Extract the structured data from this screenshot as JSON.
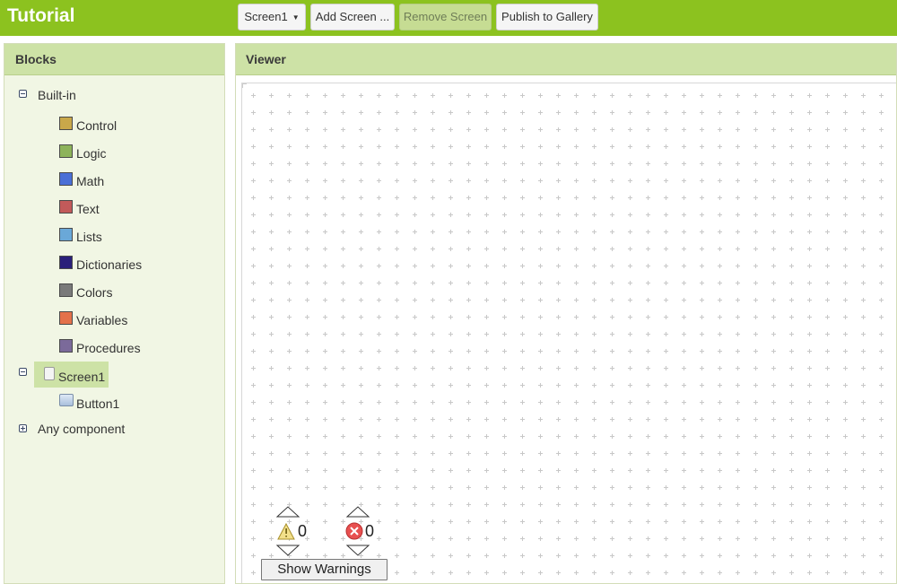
{
  "app": {
    "title": "Tutorial"
  },
  "toolbar": {
    "screen_select": "Screen1",
    "add_screen": "Add Screen ...",
    "remove_screen": "Remove Screen",
    "publish": "Publish to Gallery"
  },
  "blocks": {
    "header": "Blocks",
    "builtin_label": "Built-in",
    "builtin_items": [
      {
        "label": "Control",
        "color": "#c9a84a"
      },
      {
        "label": "Logic",
        "color": "#8db35a"
      },
      {
        "label": "Math",
        "color": "#4a6fd6"
      },
      {
        "label": "Text",
        "color": "#c25a5a"
      },
      {
        "label": "Lists",
        "color": "#6aa8d8"
      },
      {
        "label": "Dictionaries",
        "color": "#2a1f7a"
      },
      {
        "label": "Colors",
        "color": "#7a7a7a"
      },
      {
        "label": "Variables",
        "color": "#e4714a"
      },
      {
        "label": "Procedures",
        "color": "#7b6a9a"
      }
    ],
    "screen_label": "Screen1",
    "screen_children": [
      {
        "label": "Button1"
      }
    ],
    "any_component_label": "Any component"
  },
  "viewer": {
    "header": "Viewer",
    "warnings_count": "0",
    "errors_count": "0",
    "show_warnings": "Show Warnings"
  },
  "icons": {
    "warning": "warning-triangle-icon",
    "error": "error-x-icon"
  }
}
